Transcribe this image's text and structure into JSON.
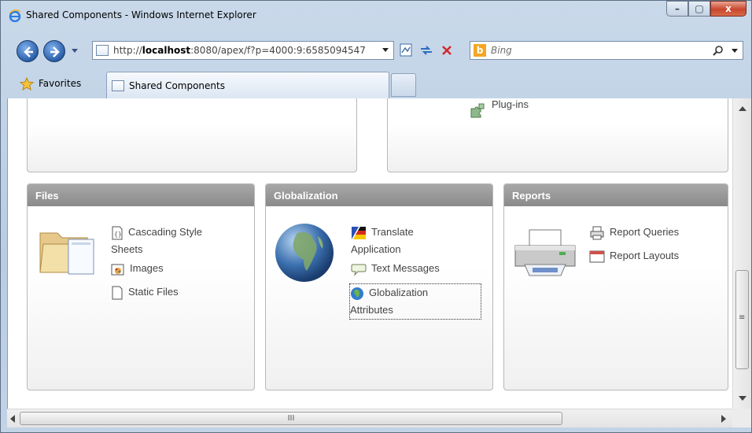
{
  "window": {
    "title": "Shared Components - Windows Internet Explorer",
    "controls": {
      "minimize": "–",
      "maximize": "▢",
      "close": "x"
    }
  },
  "navbar": {
    "url_prefix": "http://",
    "url_host": "localhost",
    "url_rest": ":8080/apex/f?p=4000:9:6585094547",
    "search_placeholder": "Bing",
    "search_logo": "b"
  },
  "favorites_bar": {
    "favorites_label": "Favorites",
    "tab_label": "Shared Components"
  },
  "regions": {
    "top_right": {
      "links": [
        {
          "label": "Plug-ins",
          "icon": "puzzle-icon"
        }
      ]
    },
    "files": {
      "title": "Files",
      "links": [
        {
          "label_line1": "Cascading Style",
          "label_line2": "Sheets",
          "icon": "css-file-icon"
        },
        {
          "label": "Images",
          "icon": "image-icon"
        },
        {
          "label": "Static Files",
          "icon": "file-icon"
        }
      ]
    },
    "globalization": {
      "title": "Globalization",
      "links": [
        {
          "label_line1": "Translate",
          "label_line2": "Application",
          "icon": "translate-flag-icon"
        },
        {
          "label": "Text Messages",
          "icon": "speech-bubble-icon"
        },
        {
          "label_line1": "Globalization",
          "label_line2": "Attributes",
          "icon": "globe-small-icon"
        }
      ]
    },
    "reports": {
      "title": "Reports",
      "links": [
        {
          "label": "Report Queries",
          "icon": "printer-small-icon"
        },
        {
          "label": "Report Layouts",
          "icon": "layout-icon"
        }
      ]
    }
  },
  "scrollbar": {
    "h_grip": "III",
    "v_grip": "≡"
  }
}
